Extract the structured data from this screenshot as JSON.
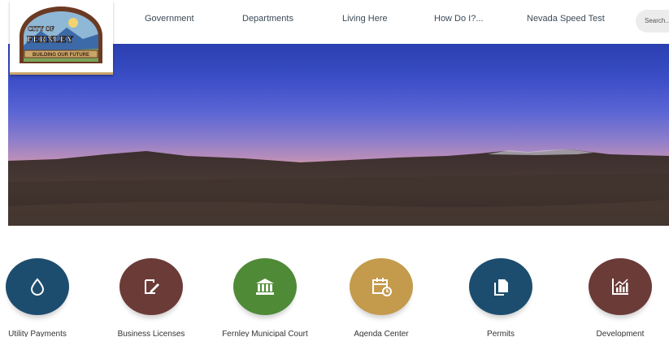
{
  "logo": {
    "top_text": "CITY OF",
    "name": "FERNLEY",
    "banner": "BUILDING OUR FUTURE"
  },
  "nav": {
    "items": [
      {
        "label": "Government"
      },
      {
        "label": "Departments"
      },
      {
        "label": "Living Here"
      },
      {
        "label": "How Do I?..."
      },
      {
        "label": "Nevada Speed Test"
      }
    ],
    "search_placeholder": "Search..."
  },
  "quick_links": [
    {
      "label": "Utility Payments",
      "icon": "water-drop-icon",
      "color": "#1d4d6e"
    },
    {
      "label": "Business Licenses",
      "icon": "edit-document-icon",
      "color": "#6b3b38"
    },
    {
      "label": "Fernley Municipal Court",
      "icon": "courthouse-icon",
      "color": "#4f8a37"
    },
    {
      "label": "Agenda Center",
      "icon": "calendar-clock-icon",
      "color": "#c49a4c"
    },
    {
      "label": "Permits",
      "icon": "documents-icon",
      "color": "#1d4d6e"
    },
    {
      "label": "Development",
      "icon": "chart-icon",
      "color": "#6b3b38"
    }
  ]
}
